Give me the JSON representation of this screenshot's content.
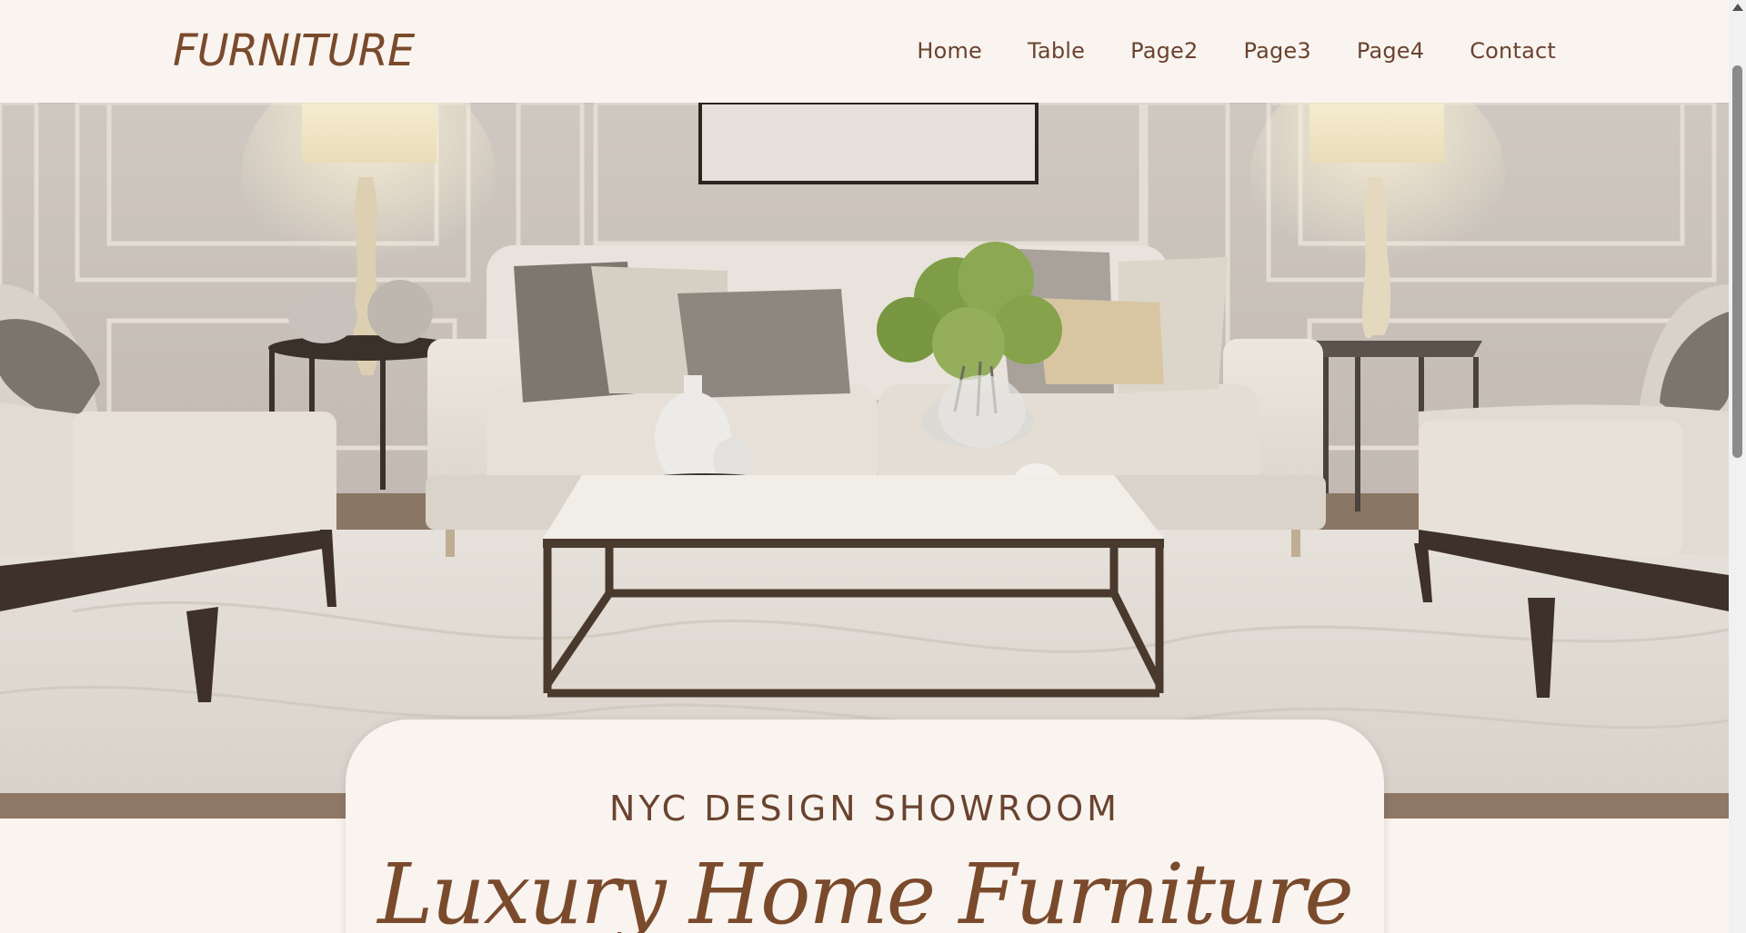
{
  "brand": {
    "logo": "FURNITURE"
  },
  "nav": {
    "items": [
      {
        "label": "Home"
      },
      {
        "label": "Table"
      },
      {
        "label": "Page2"
      },
      {
        "label": "Page3"
      },
      {
        "label": "Page4"
      },
      {
        "label": "Contact"
      }
    ]
  },
  "hero": {
    "image_subject": "living-room-with-white-sofa-coffee-table-and-armchairs"
  },
  "card": {
    "subtitle": "NYC DESIGN SHOWROOM",
    "title": "Luxury Home Furniture"
  },
  "colors": {
    "background": "#f9f4ef",
    "brand_brown": "#7a4a2c",
    "nav_text": "#6a4330"
  }
}
